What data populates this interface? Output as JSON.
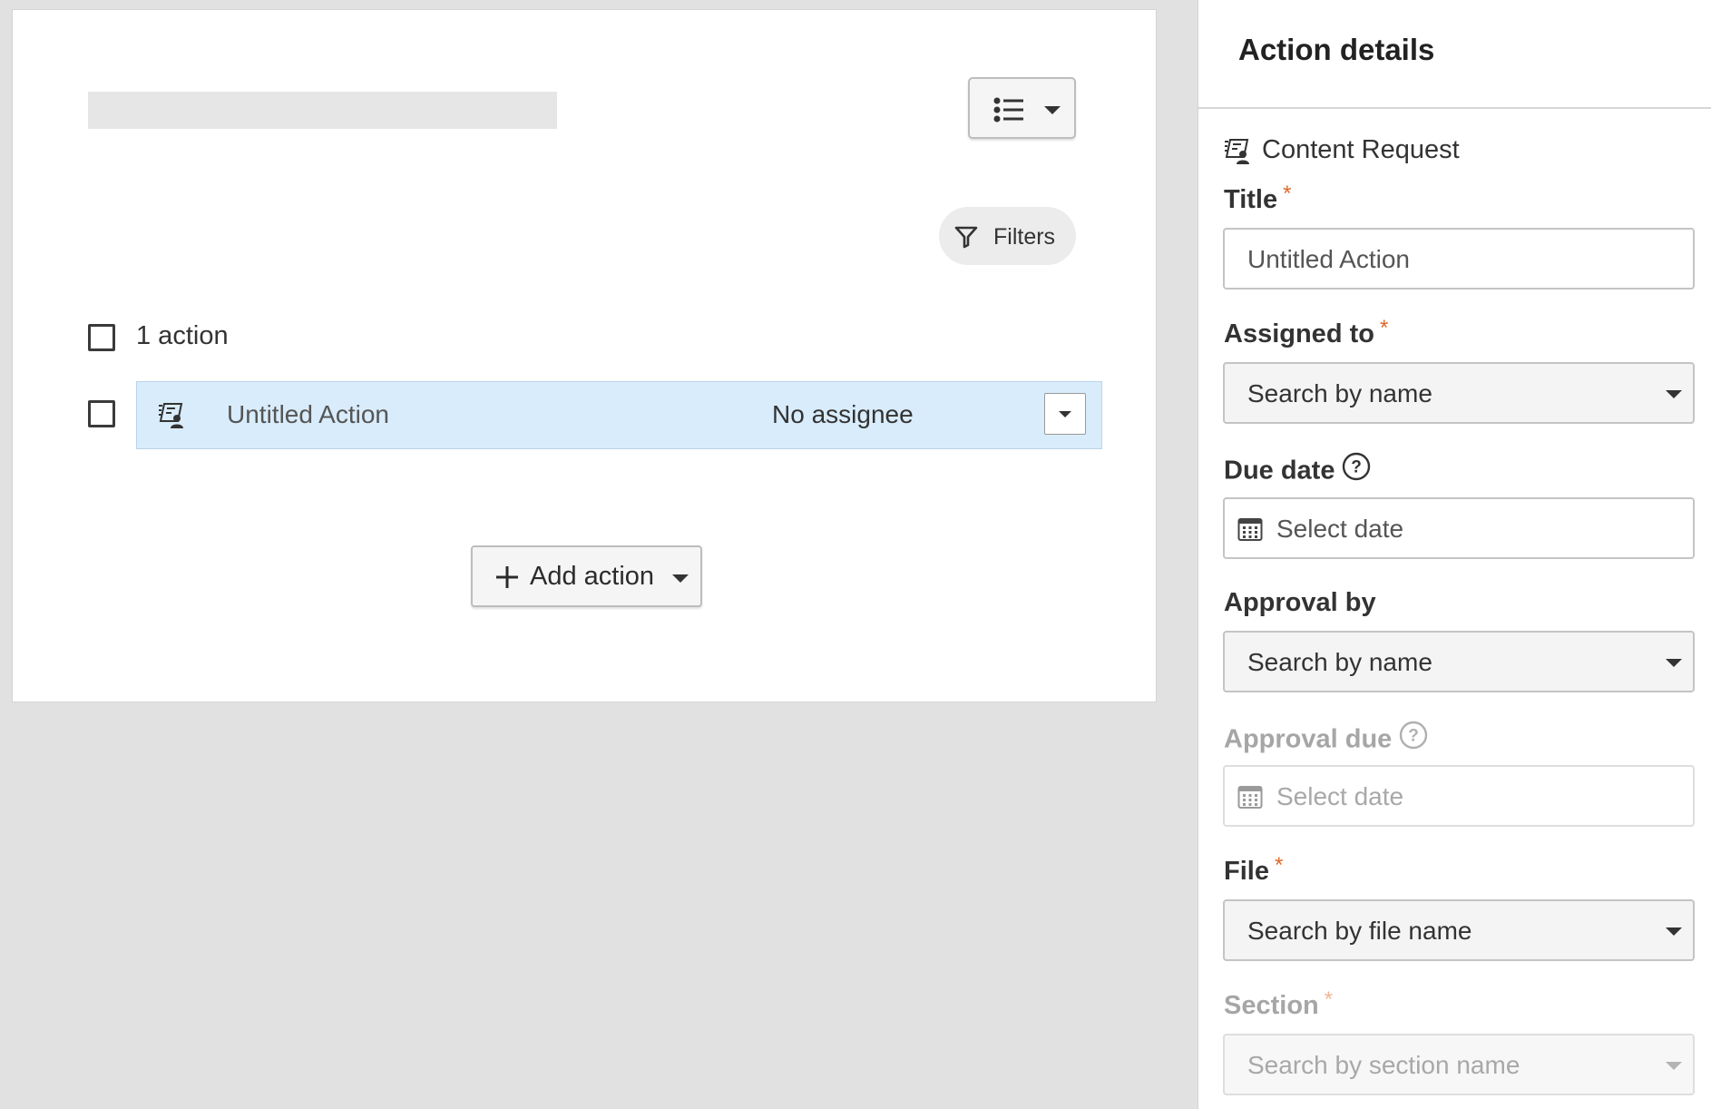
{
  "main": {
    "view_button": {
      "icon": "list-icon"
    },
    "filters_label": "Filters",
    "count_label": "1 action",
    "actions": [
      {
        "title": "Untitled Action",
        "assignee": "No assignee",
        "icon": "content-request-icon"
      }
    ],
    "add_action_label": "Add action"
  },
  "details": {
    "heading": "Action details",
    "type_label": "Content Request",
    "required_marker": "*",
    "fields": {
      "title": {
        "label": "Title",
        "value": "Untitled Action"
      },
      "assigned_to": {
        "label": "Assigned to",
        "placeholder": "Search by name"
      },
      "due_date": {
        "label": "Due date",
        "placeholder": "Select date"
      },
      "approval_by": {
        "label": "Approval by",
        "placeholder": "Search by name"
      },
      "approval_due": {
        "label": "Approval due",
        "placeholder": "Select date"
      },
      "file": {
        "label": "File",
        "placeholder": "Search by file name"
      },
      "section": {
        "label": "Section",
        "placeholder": "Search by section name"
      }
    }
  },
  "colors": {
    "accent_required": "#e0672b",
    "selected_row_bg": "#d9ecfb",
    "page_bg": "#e1e1e1"
  }
}
